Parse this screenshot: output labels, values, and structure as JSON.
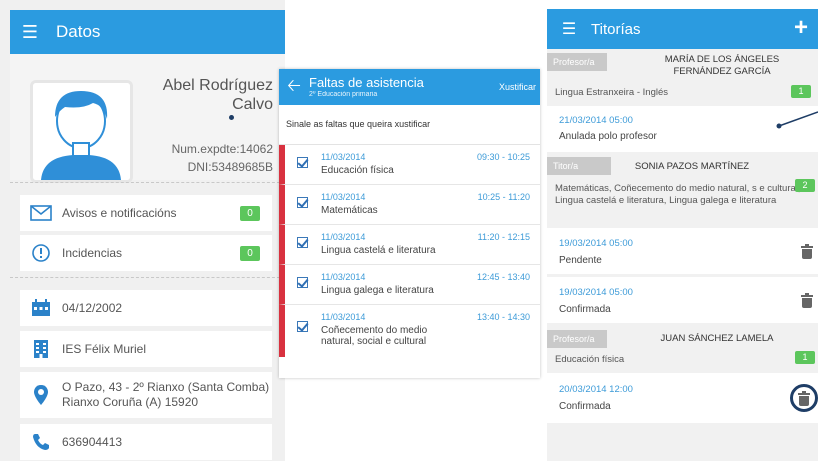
{
  "datos": {
    "title": "Datos",
    "name_line1": "Abel Rodríguez",
    "name_line2": "Calvo",
    "expediente": "Num.expdte:14062",
    "dni": "DNI:53489685B",
    "avisos_label": "Avisos e notificacións",
    "avisos_count": "0",
    "incidencias_label": "Incidencias",
    "incidencias_count": "0",
    "birth_date": "04/12/2002",
    "school": "IES Félix Muriel",
    "address_line1": "O Pazo, 43 - 2º Rianxo (Santa Comba)",
    "address_line2": "Rianxo Coruña (A) 15920",
    "phone": "636904413"
  },
  "faltas": {
    "title": "Faltas de asistencia",
    "subtitle": "2º Educación primaria",
    "justify_label": "Xustificar",
    "instruction": "Sinale as faltas que queira xustificar",
    "rows": [
      {
        "date": "11/03/2014",
        "time": "09:30 - 10:25",
        "subject": "Educación física"
      },
      {
        "date": "11/03/2014",
        "time": "10:25 - 11:20",
        "subject": "Matemáticas"
      },
      {
        "date": "11/03/2014",
        "time": "11:20 - 12:15",
        "subject": "Lingua castelá e literatura"
      },
      {
        "date": "11/03/2014",
        "time": "12:45 - 13:40",
        "subject": "Lingua galega e literatura"
      },
      {
        "date": "11/03/2014",
        "time": "13:40 - 14:30",
        "subject": "Coñecemento do medio natural, social e cultural"
      }
    ]
  },
  "titorias": {
    "title": "Titorías",
    "add_label": "+",
    "groups": [
      {
        "role": "Profesor/a",
        "teacher": "MARÍA DE LOS ÁNGELES FERNÁNDEZ GARCÍA",
        "subjects": "Lingua Estranxeira - Inglés",
        "count": "1",
        "events": [
          {
            "date": "21/03/2014 05:00",
            "status": "Anulada polo profesor"
          }
        ]
      },
      {
        "role": "Titor/a",
        "teacher": "SONIA PAZOS MARTÍNEZ",
        "subjects": "Matemáticas, Coñecemento do medio natural, s e cultural, Lingua castelá e literatura, Lingua galega e literatura",
        "count": "2",
        "events": [
          {
            "date": "19/03/2014 05:00",
            "status": "Pendente"
          },
          {
            "date": "19/03/2014 05:00",
            "status": "Confirmada"
          }
        ]
      },
      {
        "role": "Profesor/a",
        "teacher": "JUAN SÁNCHEZ LAMELA",
        "subjects": "Educación física",
        "count": "1",
        "events": [
          {
            "date": "20/03/2014 12:00",
            "status": "Confirmada"
          }
        ]
      }
    ]
  },
  "colors": {
    "header_blue": "#2b9be0",
    "badge_green": "#5cc65c",
    "absence_red": "#d8313f",
    "date_blue": "#3d9bd8",
    "callout_navy": "#1e3d66"
  }
}
